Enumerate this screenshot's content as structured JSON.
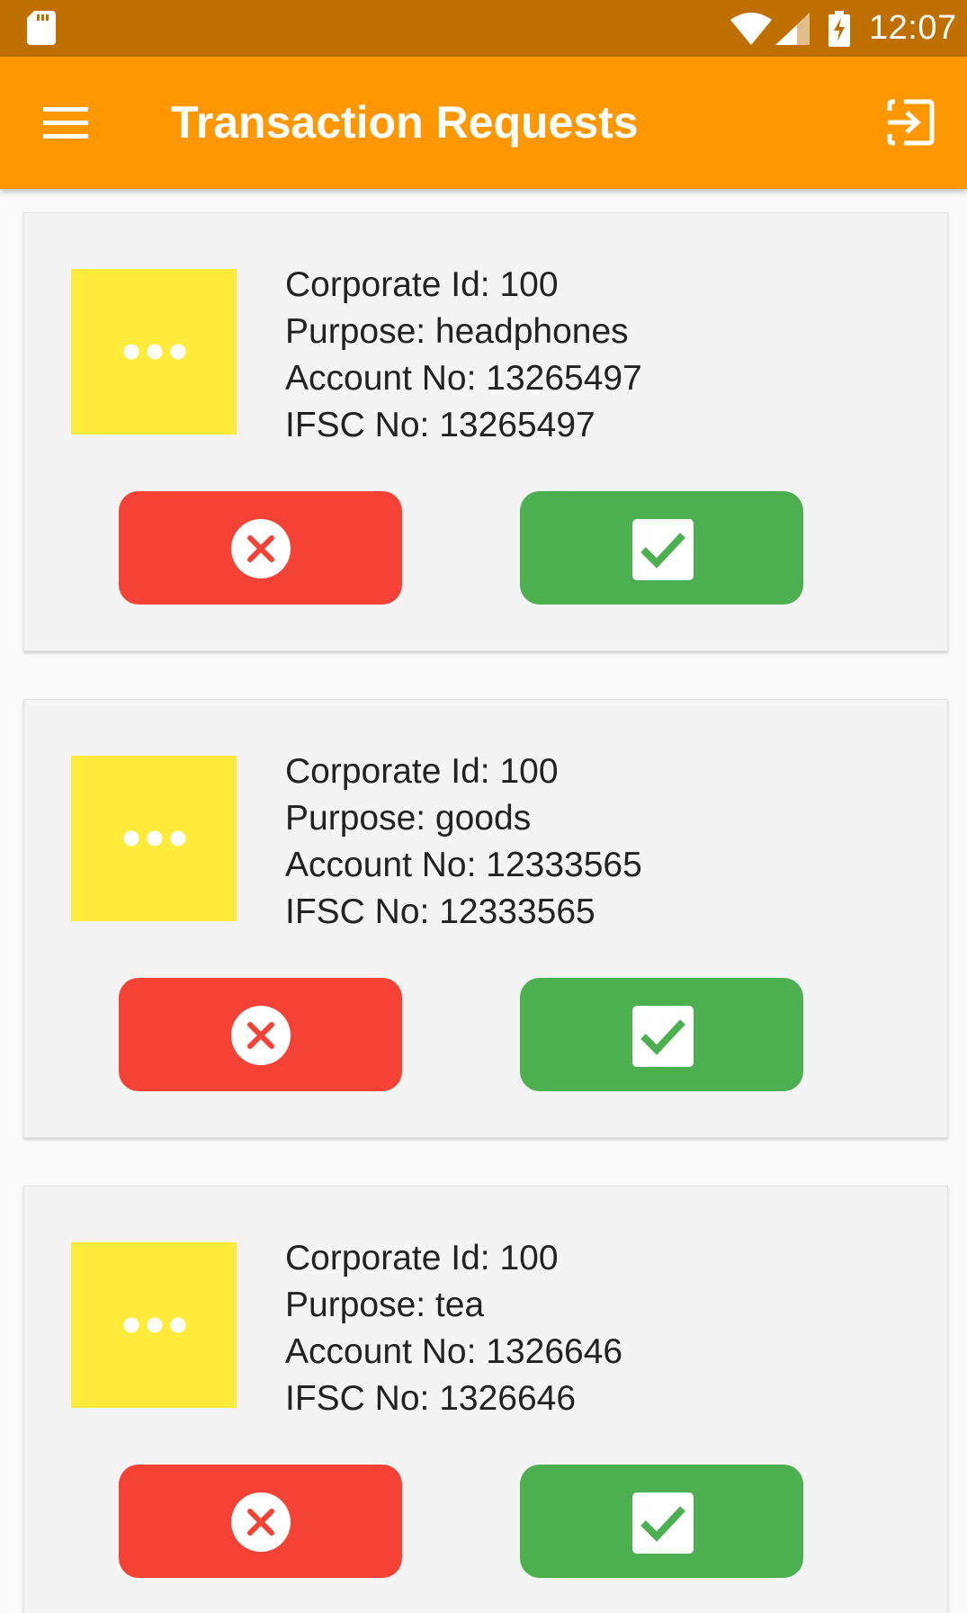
{
  "status_bar": {
    "time": "12:07",
    "icons": [
      "sd-card-icon",
      "wifi-icon",
      "signal-icon",
      "battery-charging-icon"
    ]
  },
  "app_bar": {
    "title": "Transaction Requests",
    "menu_icon": "menu-icon",
    "logout_icon": "logout-icon"
  },
  "colors": {
    "status_bar": "#bf6f00",
    "app_bar": "#ff9800",
    "thumb": "#ffeb3b",
    "reject": "#f44336",
    "accept": "#4caf50"
  },
  "requests": [
    {
      "corporate_id": "Corporate Id: 100",
      "purpose": "Purpose: headphones",
      "account_no": "Account No: 13265497",
      "ifsc_no": "IFSC No: 13265497"
    },
    {
      "corporate_id": "Corporate Id: 100",
      "purpose": "Purpose: goods",
      "account_no": "Account No: 12333565",
      "ifsc_no": "IFSC No: 12333565"
    },
    {
      "corporate_id": "Corporate Id: 100",
      "purpose": "Purpose: tea",
      "account_no": "Account No: 1326646",
      "ifsc_no": "IFSC No: 1326646"
    }
  ]
}
